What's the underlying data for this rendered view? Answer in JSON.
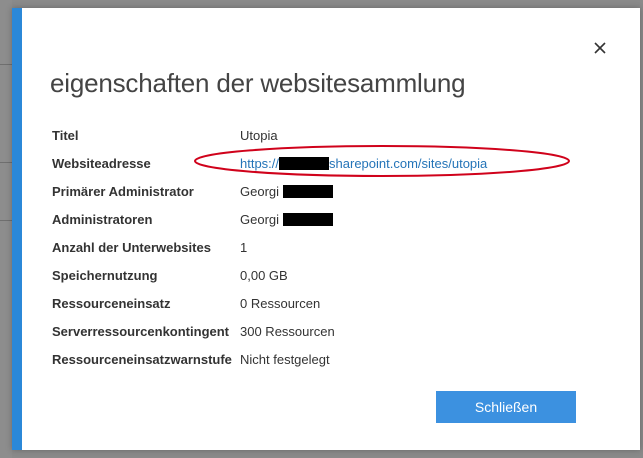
{
  "dialog": {
    "title": "eigenschaften der websitesammlung",
    "close_label": "Schließen"
  },
  "properties": {
    "titel": {
      "label": "Titel",
      "value": "Utopia"
    },
    "websiteadresse": {
      "label": "Websiteadresse",
      "value_prefix": "https://",
      "value_suffix": "sharepoint.com/sites/utopia"
    },
    "primaerer_admin": {
      "label": "Primärer Administrator",
      "value": "Georgi"
    },
    "administratoren": {
      "label": "Administratoren",
      "value": "Georgi"
    },
    "unterwebsites": {
      "label": "Anzahl der Unterwebsites",
      "value": "1"
    },
    "speicher": {
      "label": "Speichernutzung",
      "value": "0,00 GB"
    },
    "ressourceneinsatz": {
      "label": "Ressourceneinsatz",
      "value": "0 Ressourcen"
    },
    "kontingent": {
      "label": "Serverressourcenkontingent",
      "value": "300 Ressourcen"
    },
    "warnstufe": {
      "label": "Ressourceneinsatzwarnstufe",
      "value": "Nicht festgelegt"
    }
  },
  "colors": {
    "accent": "#2b88d8",
    "button": "#3c91e0",
    "link": "#2474b8",
    "annotation": "#d0021b"
  },
  "icons": {
    "close": "close-icon"
  }
}
